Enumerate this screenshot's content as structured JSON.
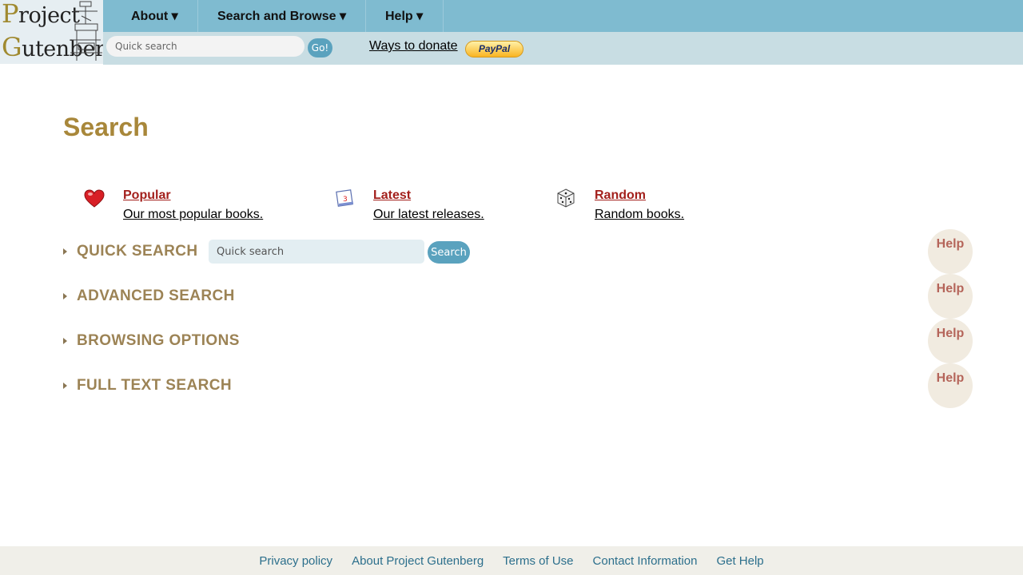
{
  "logo": {
    "line1": "Project",
    "line2": "Gutenberg"
  },
  "nav": {
    "items": [
      {
        "label": "About ▾"
      },
      {
        "label": "Search and Browse ▾"
      },
      {
        "label": "Help ▾"
      }
    ]
  },
  "header_search": {
    "placeholder": "Quick search",
    "go_label": "Go!"
  },
  "donate": {
    "link": "Ways to donate",
    "paypal": "PayPal"
  },
  "page_title": "Search",
  "features": [
    {
      "label": "Popular",
      "desc": "Our most popular books.",
      "icon": "heart-icon"
    },
    {
      "label": "Latest",
      "desc": "Our latest releases.",
      "icon": "calendar-icon",
      "icon_text": "3"
    },
    {
      "label": "Random",
      "desc": "Random books.",
      "icon": "dice-icon"
    }
  ],
  "sections": [
    {
      "title": "QUICK SEARCH",
      "help": "Help"
    },
    {
      "title": "ADVANCED SEARCH",
      "help": "Help"
    },
    {
      "title": "BROWSING OPTIONS",
      "help": "Help"
    },
    {
      "title": "FULL TEXT SEARCH",
      "help": "Help"
    }
  ],
  "quick_search": {
    "placeholder": "Quick search",
    "button": "Search"
  },
  "footer": {
    "links": [
      "Privacy policy",
      "About Project Gutenberg",
      "Terms of Use",
      "Contact Information",
      "Get Help"
    ]
  },
  "colors": {
    "nav_bg": "#7fbbd0",
    "subnav_bg": "#c8dde3",
    "title": "#a8873a",
    "link_red": "#a3201c",
    "section_title": "#9c8355",
    "button": "#5aa2be"
  }
}
